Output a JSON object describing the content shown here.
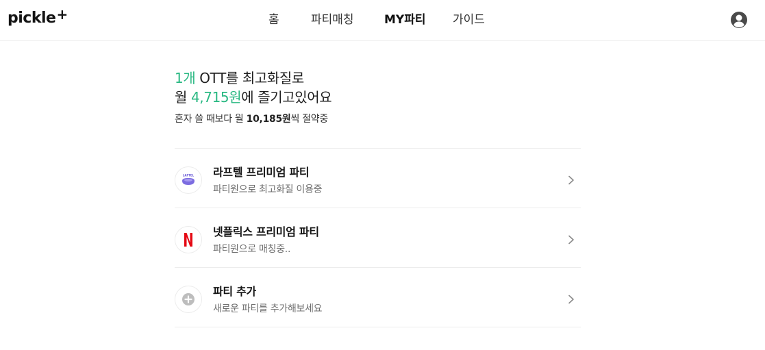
{
  "brand": {
    "name": "pickle",
    "plus": "+"
  },
  "nav": {
    "items": [
      {
        "label": "홈"
      },
      {
        "label": "파티매칭"
      },
      {
        "label": "MY파티"
      },
      {
        "label": "가이드"
      }
    ],
    "active": "MY파티"
  },
  "summary": {
    "line1_count": "1개",
    "line1_rest": " OTT를 최고화질로",
    "line2_prefix": "월 ",
    "line2_price": "4,715원",
    "line2_suffix": "에 즐기고있어요",
    "saving_prefix": "혼자 쓸 때보다 월 ",
    "saving_amount": "10,185원",
    "saving_suffix": "씩 절약중"
  },
  "parties": [
    {
      "title": "라프텔 프리미엄 파티",
      "subtitle": "파티원으로 최고화질 이용중",
      "icon": "laftel-logo-icon"
    },
    {
      "title": "넷플릭스 프리미엄 파티",
      "subtitle": "파티원으로 매칭중..",
      "icon": "netflix-logo-icon"
    },
    {
      "title": "파티 추가",
      "subtitle": "새로운 파티를 추가해보세요",
      "icon": "plus-circle-icon"
    }
  ],
  "colors": {
    "accent": "#29b882",
    "netflix_red": "#e50914",
    "laftel_purple": "#7c6ce0"
  }
}
